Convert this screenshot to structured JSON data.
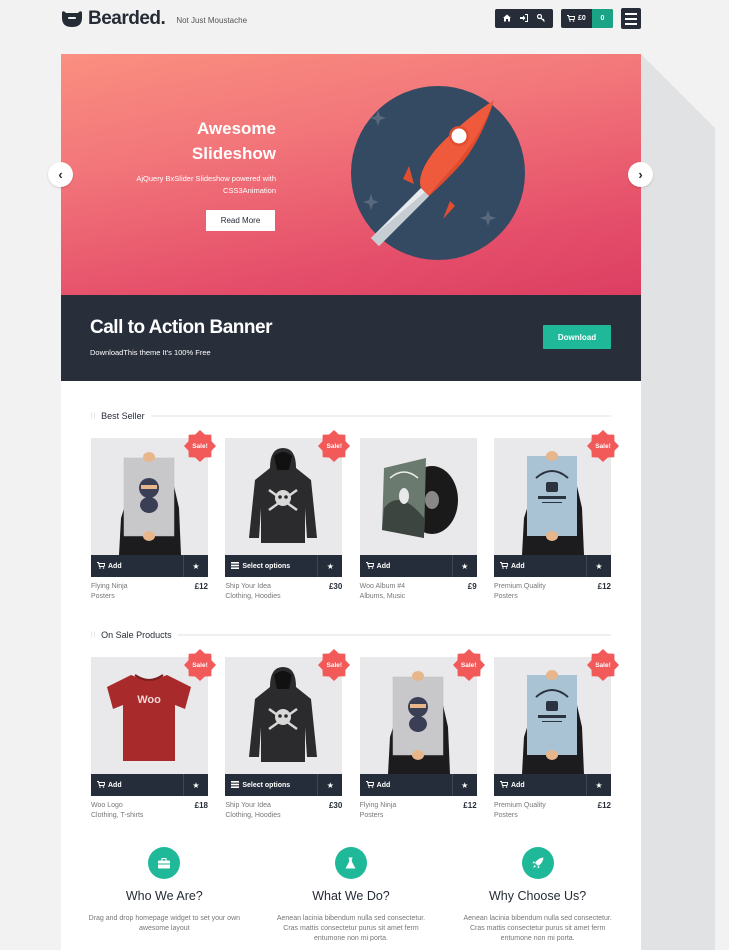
{
  "header": {
    "logo_text": "Bearded.",
    "tagline": "Not Just Moustache",
    "account_icons": [
      "home-icon",
      "sign-in-icon",
      "key-icon"
    ],
    "cart_total": "£0",
    "cart_count": "0",
    "menu_icon": "hamburger-icon"
  },
  "slider": {
    "title_line1": "Awesome",
    "title_line2": "Slideshow",
    "subtitle_line1": "AjQuery BxSlider Slideshow powered with",
    "subtitle_line2": "CSS3Animation",
    "button_label": "Read More",
    "prev_label": "‹",
    "next_label": "›"
  },
  "cta": {
    "title": "Call to Action Banner",
    "subtitle": "DownloadThis theme It's 100% Free",
    "button_label": "Download"
  },
  "best_seller": {
    "title": "Best Seller",
    "products": [
      {
        "name": "Flying Ninja",
        "categories": "Posters",
        "price": "£12",
        "action": "Add",
        "action_icon": "cart-icon",
        "sale": "Sale!",
        "image": "ninja-poster"
      },
      {
        "name": "Ship Your Idea",
        "categories": "Clothing, Hoodies",
        "price": "£30",
        "action": "Select options",
        "action_icon": "list-icon",
        "sale": "Sale!",
        "image": "hoodie"
      },
      {
        "name": "Woo Album #4",
        "categories": "Albums, Music",
        "price": "£9",
        "action": "Add",
        "action_icon": "cart-icon",
        "sale": "",
        "image": "album"
      },
      {
        "name": "Premium Quality",
        "categories": "Posters",
        "price": "£12",
        "action": "Add",
        "action_icon": "cart-icon",
        "sale": "Sale!",
        "image": "woothemes-poster"
      }
    ]
  },
  "on_sale": {
    "title": "On Sale Products",
    "products": [
      {
        "name": "Woo Logo",
        "categories": "Clothing, T-shirts",
        "price": "£18",
        "action": "Add",
        "action_icon": "cart-icon",
        "sale": "Sale!",
        "image": "tshirt"
      },
      {
        "name": "Ship Your Idea",
        "categories": "Clothing, Hoodies",
        "price": "£30",
        "action": "Select options",
        "action_icon": "list-icon",
        "sale": "Sale!",
        "image": "hoodie"
      },
      {
        "name": "Flying Ninja",
        "categories": "Posters",
        "price": "£12",
        "action": "Add",
        "action_icon": "cart-icon",
        "sale": "Sale!",
        "image": "ninja-poster"
      },
      {
        "name": "Premium Quality",
        "categories": "Posters",
        "price": "£12",
        "action": "Add",
        "action_icon": "cart-icon",
        "sale": "Sale!",
        "image": "woothemes-poster"
      }
    ]
  },
  "features": [
    {
      "icon": "briefcase-icon",
      "title": "Who We Are?",
      "text": "Drag and drop homepage widget to set your own awesome layout"
    },
    {
      "icon": "flask-icon",
      "title": "What We Do?",
      "text": "Aenean lacinia bibendum nulla sed consectetur. Cras mattis consectetur purus sit amet ferm entumone non mi porta."
    },
    {
      "icon": "rocket-icon",
      "title": "Why Choose Us?",
      "text": "Aenean lacinia bibendum nulla sed consectetur. Cras mattis consectetur purus sit amet ferm entumone non mi porta."
    }
  ],
  "colors": {
    "accent": "#1fb99a",
    "dark": "#262c38",
    "sale": "#f25a5a",
    "cart_count_bg": "#1aa384"
  }
}
